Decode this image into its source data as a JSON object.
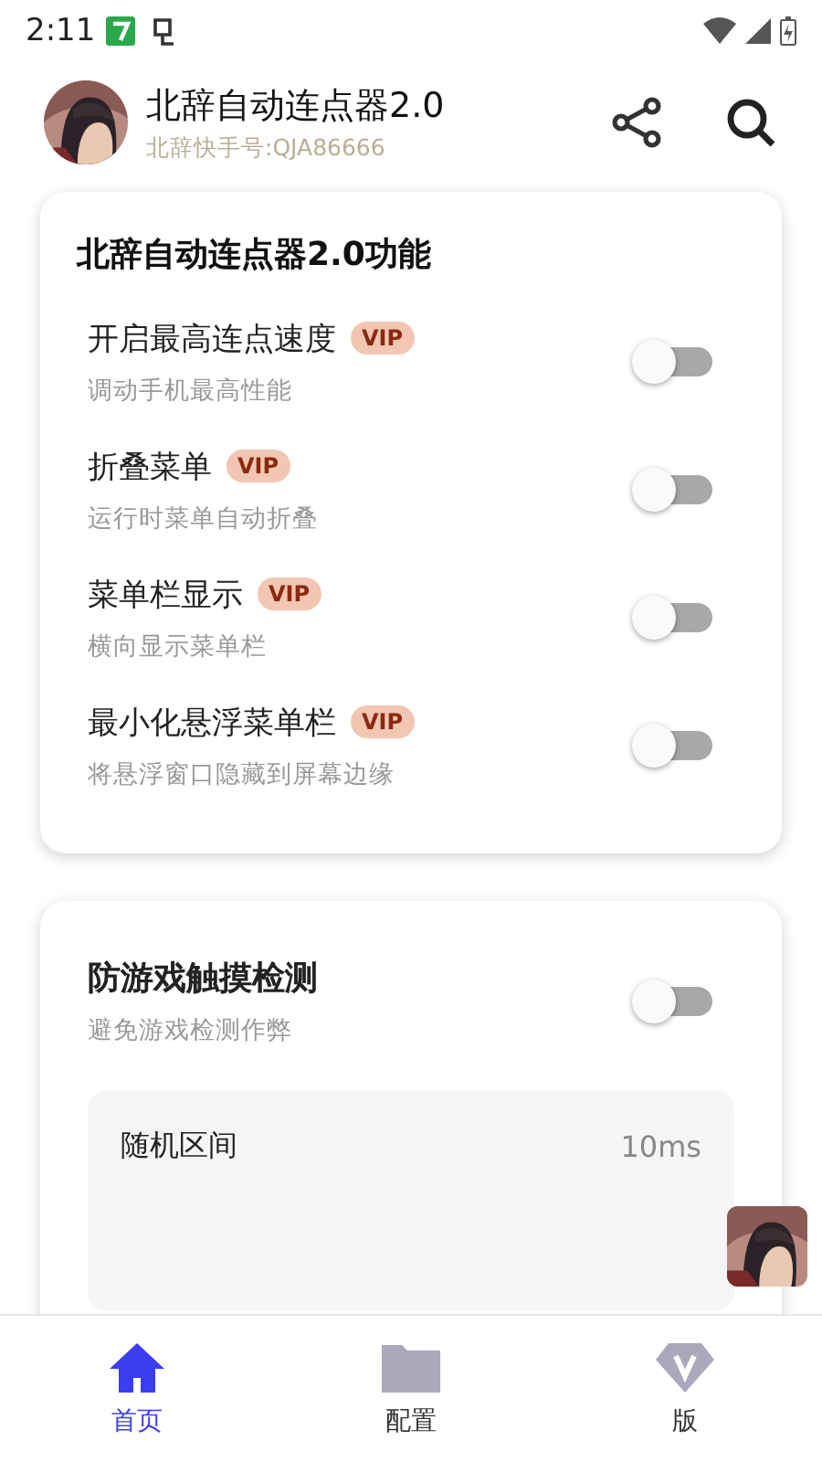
{
  "status_bar": {
    "time": "2:11"
  },
  "header": {
    "title": "北辞自动连点器2.0",
    "subtitle": "北辞快手号:QJA86666"
  },
  "feature_card": {
    "title": "北辞自动连点器2.0功能",
    "items": [
      {
        "label": "开启最高连点速度",
        "badge": "VIP",
        "description": "调动手机最高性能",
        "on": false
      },
      {
        "label": "折叠菜单",
        "badge": "VIP",
        "description": "运行时菜单自动折叠",
        "on": false
      },
      {
        "label": "菜单栏显示",
        "badge": "VIP",
        "description": "横向显示菜单栏",
        "on": false
      },
      {
        "label": "最小化悬浮菜单栏",
        "badge": "VIP",
        "description": "将悬浮窗口隐藏到屏幕边缘",
        "on": false
      }
    ]
  },
  "anti_detect_card": {
    "title": "防游戏触摸检测",
    "description": "避免游戏检测作弊",
    "on": false,
    "settings": [
      {
        "label": "随机区间",
        "value": "10ms"
      }
    ]
  },
  "bottom_nav": [
    {
      "label": "首页",
      "kind": "home",
      "selected": true
    },
    {
      "label": "配置",
      "kind": "folder",
      "selected": false
    },
    {
      "label": "版",
      "kind": "diamond",
      "selected": false
    }
  ]
}
